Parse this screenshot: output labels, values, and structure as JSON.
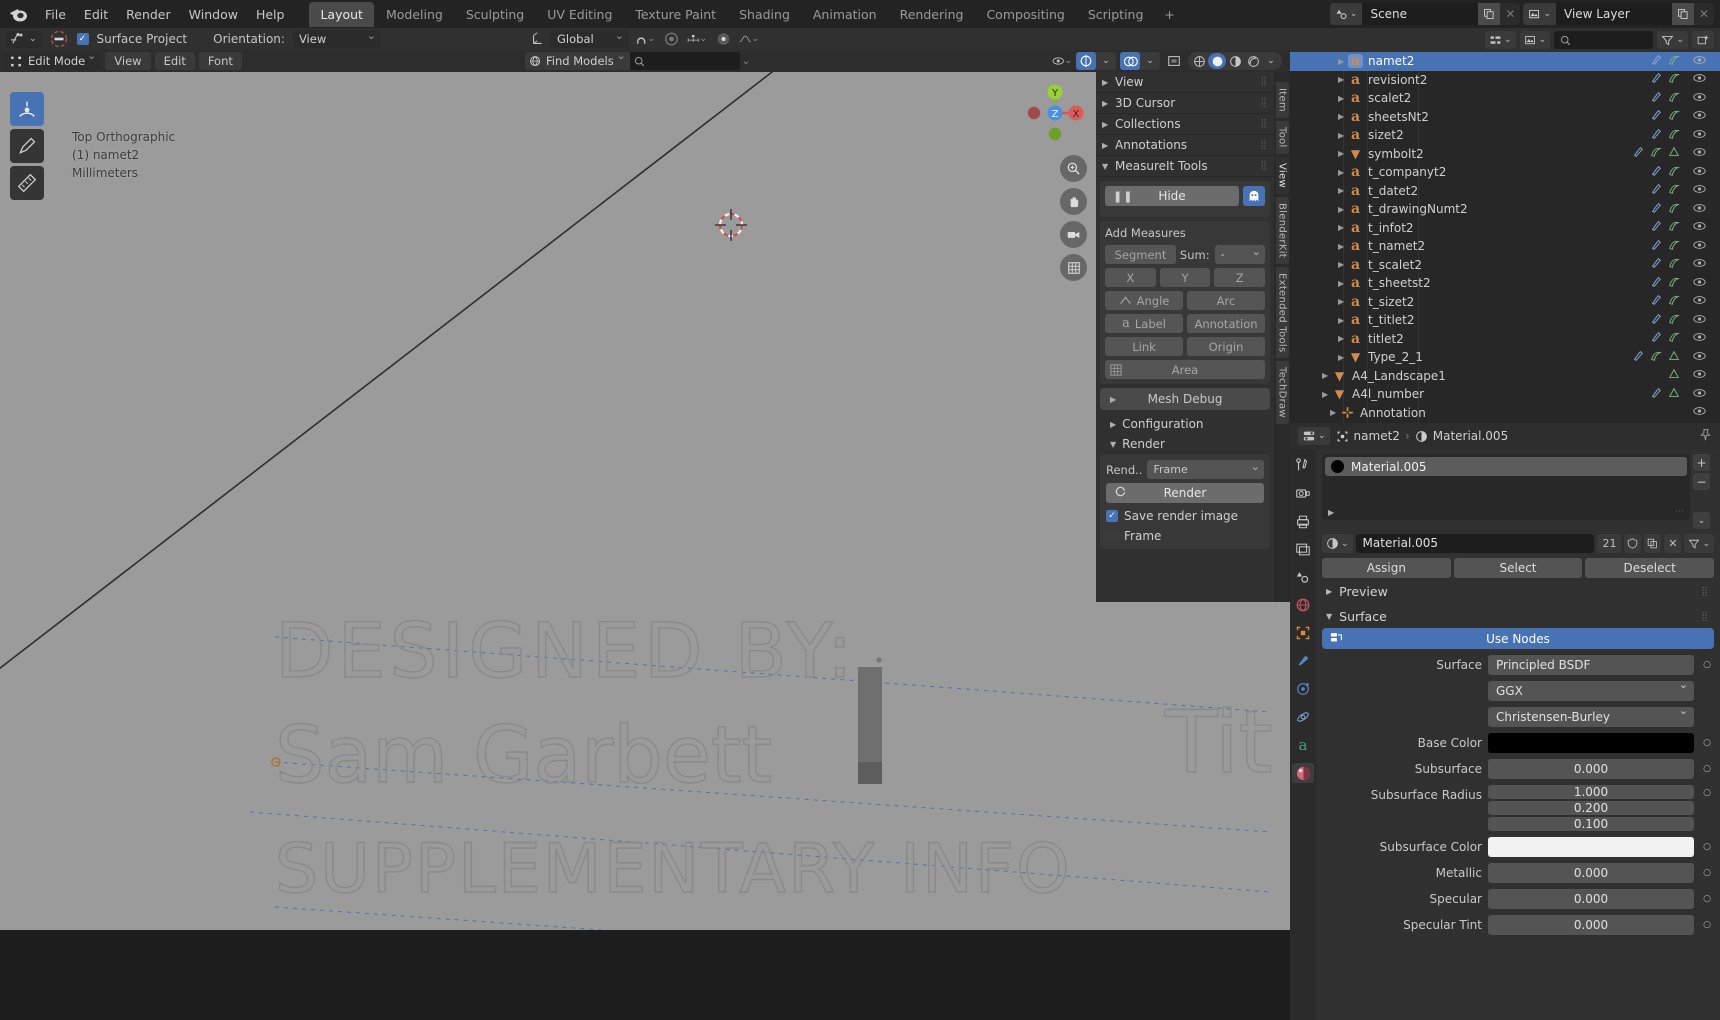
{
  "topbar": {
    "menus": [
      "File",
      "Edit",
      "Render",
      "Window",
      "Help"
    ],
    "workspaces": [
      {
        "label": "Layout",
        "active": true
      },
      {
        "label": "Modeling",
        "active": false
      },
      {
        "label": "Sculpting",
        "active": false
      },
      {
        "label": "UV Editing",
        "active": false
      },
      {
        "label": "Texture Paint",
        "active": false
      },
      {
        "label": "Shading",
        "active": false
      },
      {
        "label": "Animation",
        "active": false
      },
      {
        "label": "Rendering",
        "active": false
      },
      {
        "label": "Compositing",
        "active": false
      },
      {
        "label": "Scripting",
        "active": false
      },
      {
        "label": "+",
        "active": false
      }
    ],
    "scene_name": "Scene",
    "view_layer_name": "View Layer"
  },
  "tool_settings": {
    "surface_project_label": "Surface Project",
    "surface_project_checked": true,
    "orientation_label": "Orientation:",
    "orientation_value": "View",
    "transform_orientation": "Global"
  },
  "viewport_header": {
    "mode": "Edit Mode",
    "menus": [
      "View",
      "Edit",
      "Font"
    ],
    "find_models_label": "Find Models",
    "find_models_placeholder": ""
  },
  "viewport": {
    "view_name": "Top Orthographic",
    "object_name": "(1) namet2",
    "units": "Millimeters",
    "gizmo_axes": [
      "X",
      "Y",
      "Z"
    ],
    "background_text": [
      "DESIGNED BY:",
      "Sam Garbett",
      "SUPPLEMENTARY INFO",
      "Info"
    ],
    "right_text": [
      "Tit",
      "Tit"
    ]
  },
  "npanel": {
    "tabs": [
      {
        "label": "Item",
        "active": false
      },
      {
        "label": "Tool",
        "active": false
      },
      {
        "label": "View",
        "active": true
      },
      {
        "label": "BlenderKit",
        "active": false
      },
      {
        "label": "Extended Tools",
        "active": false
      },
      {
        "label": "TechDraw",
        "active": false
      }
    ],
    "sections": [
      {
        "label": "View",
        "open": false
      },
      {
        "label": "3D Cursor",
        "open": false
      },
      {
        "label": "Collections",
        "open": false
      },
      {
        "label": "Annotations",
        "open": false
      },
      {
        "label": "MeasureIt Tools",
        "open": true
      }
    ],
    "hide_label": "Hide",
    "add_measures_label": "Add Measures",
    "segment_label": "Segment",
    "sum_label": "Sum:",
    "sum_value": "-",
    "axis_buttons": [
      "X",
      "Y",
      "Z"
    ],
    "angle_label": "Angle",
    "arc_label": "Arc",
    "label_label": "Label",
    "annotation_label": "Annotation",
    "link_label": "Link",
    "origin_label": "Origin",
    "area_label": "Area",
    "mesh_debug_label": "Mesh Debug",
    "configuration_label": "Configuration",
    "render_section_label": "Render",
    "rend_label": "Rend..",
    "rend_value": "Frame",
    "render_button_label": "Render",
    "save_render_image_label": "Save render image",
    "save_render_image_checked": true,
    "frame_label": "Frame",
    "frame_checked": false
  },
  "outliner": {
    "search_placeholder": "",
    "rows": [
      {
        "name": "namet2",
        "icon": "font-object-icon",
        "glyph": "a",
        "selected": true,
        "indent": 48,
        "badges": [
          "mod",
          "data"
        ]
      },
      {
        "name": "revisiont2",
        "icon": "font-object-icon",
        "glyph": "a",
        "selected": false,
        "indent": 48,
        "badges": [
          "mod",
          "data"
        ]
      },
      {
        "name": "scalet2",
        "icon": "font-object-icon",
        "glyph": "a",
        "selected": false,
        "indent": 48,
        "badges": [
          "mod",
          "data"
        ]
      },
      {
        "name": "sheetsNt2",
        "icon": "font-object-icon",
        "glyph": "a",
        "selected": false,
        "indent": 48,
        "badges": [
          "mod",
          "data"
        ]
      },
      {
        "name": "sizet2",
        "icon": "font-object-icon",
        "glyph": "a",
        "selected": false,
        "indent": 48,
        "badges": [
          "mod",
          "data"
        ]
      },
      {
        "name": "symbolt2",
        "icon": "mesh-object-icon",
        "glyph": "▼",
        "selected": false,
        "indent": 48,
        "badges": [
          "mod",
          "data",
          "mat"
        ]
      },
      {
        "name": "t_companyt2",
        "icon": "font-object-icon",
        "glyph": "a",
        "selected": false,
        "indent": 48,
        "badges": [
          "mod",
          "data"
        ]
      },
      {
        "name": "t_datet2",
        "icon": "font-object-icon",
        "glyph": "a",
        "selected": false,
        "indent": 48,
        "badges": [
          "mod",
          "data"
        ]
      },
      {
        "name": "t_drawingNumt2",
        "icon": "font-object-icon",
        "glyph": "a",
        "selected": false,
        "indent": 48,
        "badges": [
          "mod",
          "data"
        ]
      },
      {
        "name": "t_infot2",
        "icon": "font-object-icon",
        "glyph": "a",
        "selected": false,
        "indent": 48,
        "badges": [
          "mod",
          "data"
        ]
      },
      {
        "name": "t_namet2",
        "icon": "font-object-icon",
        "glyph": "a",
        "selected": false,
        "indent": 48,
        "badges": [
          "mod",
          "data"
        ]
      },
      {
        "name": "t_scalet2",
        "icon": "font-object-icon",
        "glyph": "a",
        "selected": false,
        "indent": 48,
        "badges": [
          "mod",
          "data"
        ]
      },
      {
        "name": "t_sheetst2",
        "icon": "font-object-icon",
        "glyph": "a",
        "selected": false,
        "indent": 48,
        "badges": [
          "mod",
          "data"
        ]
      },
      {
        "name": "t_sizet2",
        "icon": "font-object-icon",
        "glyph": "a",
        "selected": false,
        "indent": 48,
        "badges": [
          "mod",
          "data"
        ]
      },
      {
        "name": "t_titlet2",
        "icon": "font-object-icon",
        "glyph": "a",
        "selected": false,
        "indent": 48,
        "badges": [
          "mod",
          "data"
        ]
      },
      {
        "name": "titlet2",
        "icon": "font-object-icon",
        "glyph": "a",
        "selected": false,
        "indent": 48,
        "badges": [
          "mod",
          "data"
        ]
      },
      {
        "name": "Type_2_1",
        "icon": "mesh-object-icon",
        "glyph": "▼",
        "selected": false,
        "indent": 48,
        "badges": [
          "mod",
          "data",
          "mat"
        ]
      },
      {
        "name": "A4_Landscape1",
        "icon": "mesh-object-icon",
        "glyph": "▼",
        "selected": false,
        "indent": 32,
        "badges": [
          "mat"
        ]
      },
      {
        "name": "A4l_number",
        "icon": "mesh-object-icon",
        "glyph": "▼",
        "selected": false,
        "indent": 32,
        "badges": [
          "mod",
          "mat"
        ]
      },
      {
        "name": "Annotation",
        "icon": "empty-object-icon",
        "glyph": "⊹",
        "selected": false,
        "indent": 40,
        "badges": []
      }
    ]
  },
  "properties": {
    "breadcrumb_object": "namet2",
    "breadcrumb_material": "Material.005",
    "material_slot_name": "Material.005",
    "material_name": "Material.005",
    "material_users": "21",
    "assign_label": "Assign",
    "select_label": "Select",
    "deselect_label": "Deselect",
    "preview_label": "Preview",
    "surface_section_label": "Surface",
    "use_nodes_label": "Use Nodes",
    "fields": [
      {
        "label": "Surface",
        "value": "Principled BSDF",
        "type": "menu",
        "align": "left"
      },
      {
        "label": "",
        "value": "GGX",
        "type": "dropdown",
        "align": "left"
      },
      {
        "label": "",
        "value": "Christensen-Burley",
        "type": "dropdown",
        "align": "left"
      },
      {
        "label": "Base Color",
        "value": "",
        "type": "color",
        "color": "#000000"
      },
      {
        "label": "Subsurface",
        "value": "0.000",
        "type": "number"
      },
      {
        "label": "Subsurface Radius",
        "value": [
          "1.000",
          "0.200",
          "0.100"
        ],
        "type": "vector"
      },
      {
        "label": "Subsurface Color",
        "value": "",
        "type": "color",
        "color": "#f2f2f2"
      },
      {
        "label": "Metallic",
        "value": "0.000",
        "type": "number"
      },
      {
        "label": "Specular",
        "value": "0.000",
        "type": "number"
      },
      {
        "label": "Specular Tint",
        "value": "0.000",
        "type": "number"
      }
    ]
  }
}
